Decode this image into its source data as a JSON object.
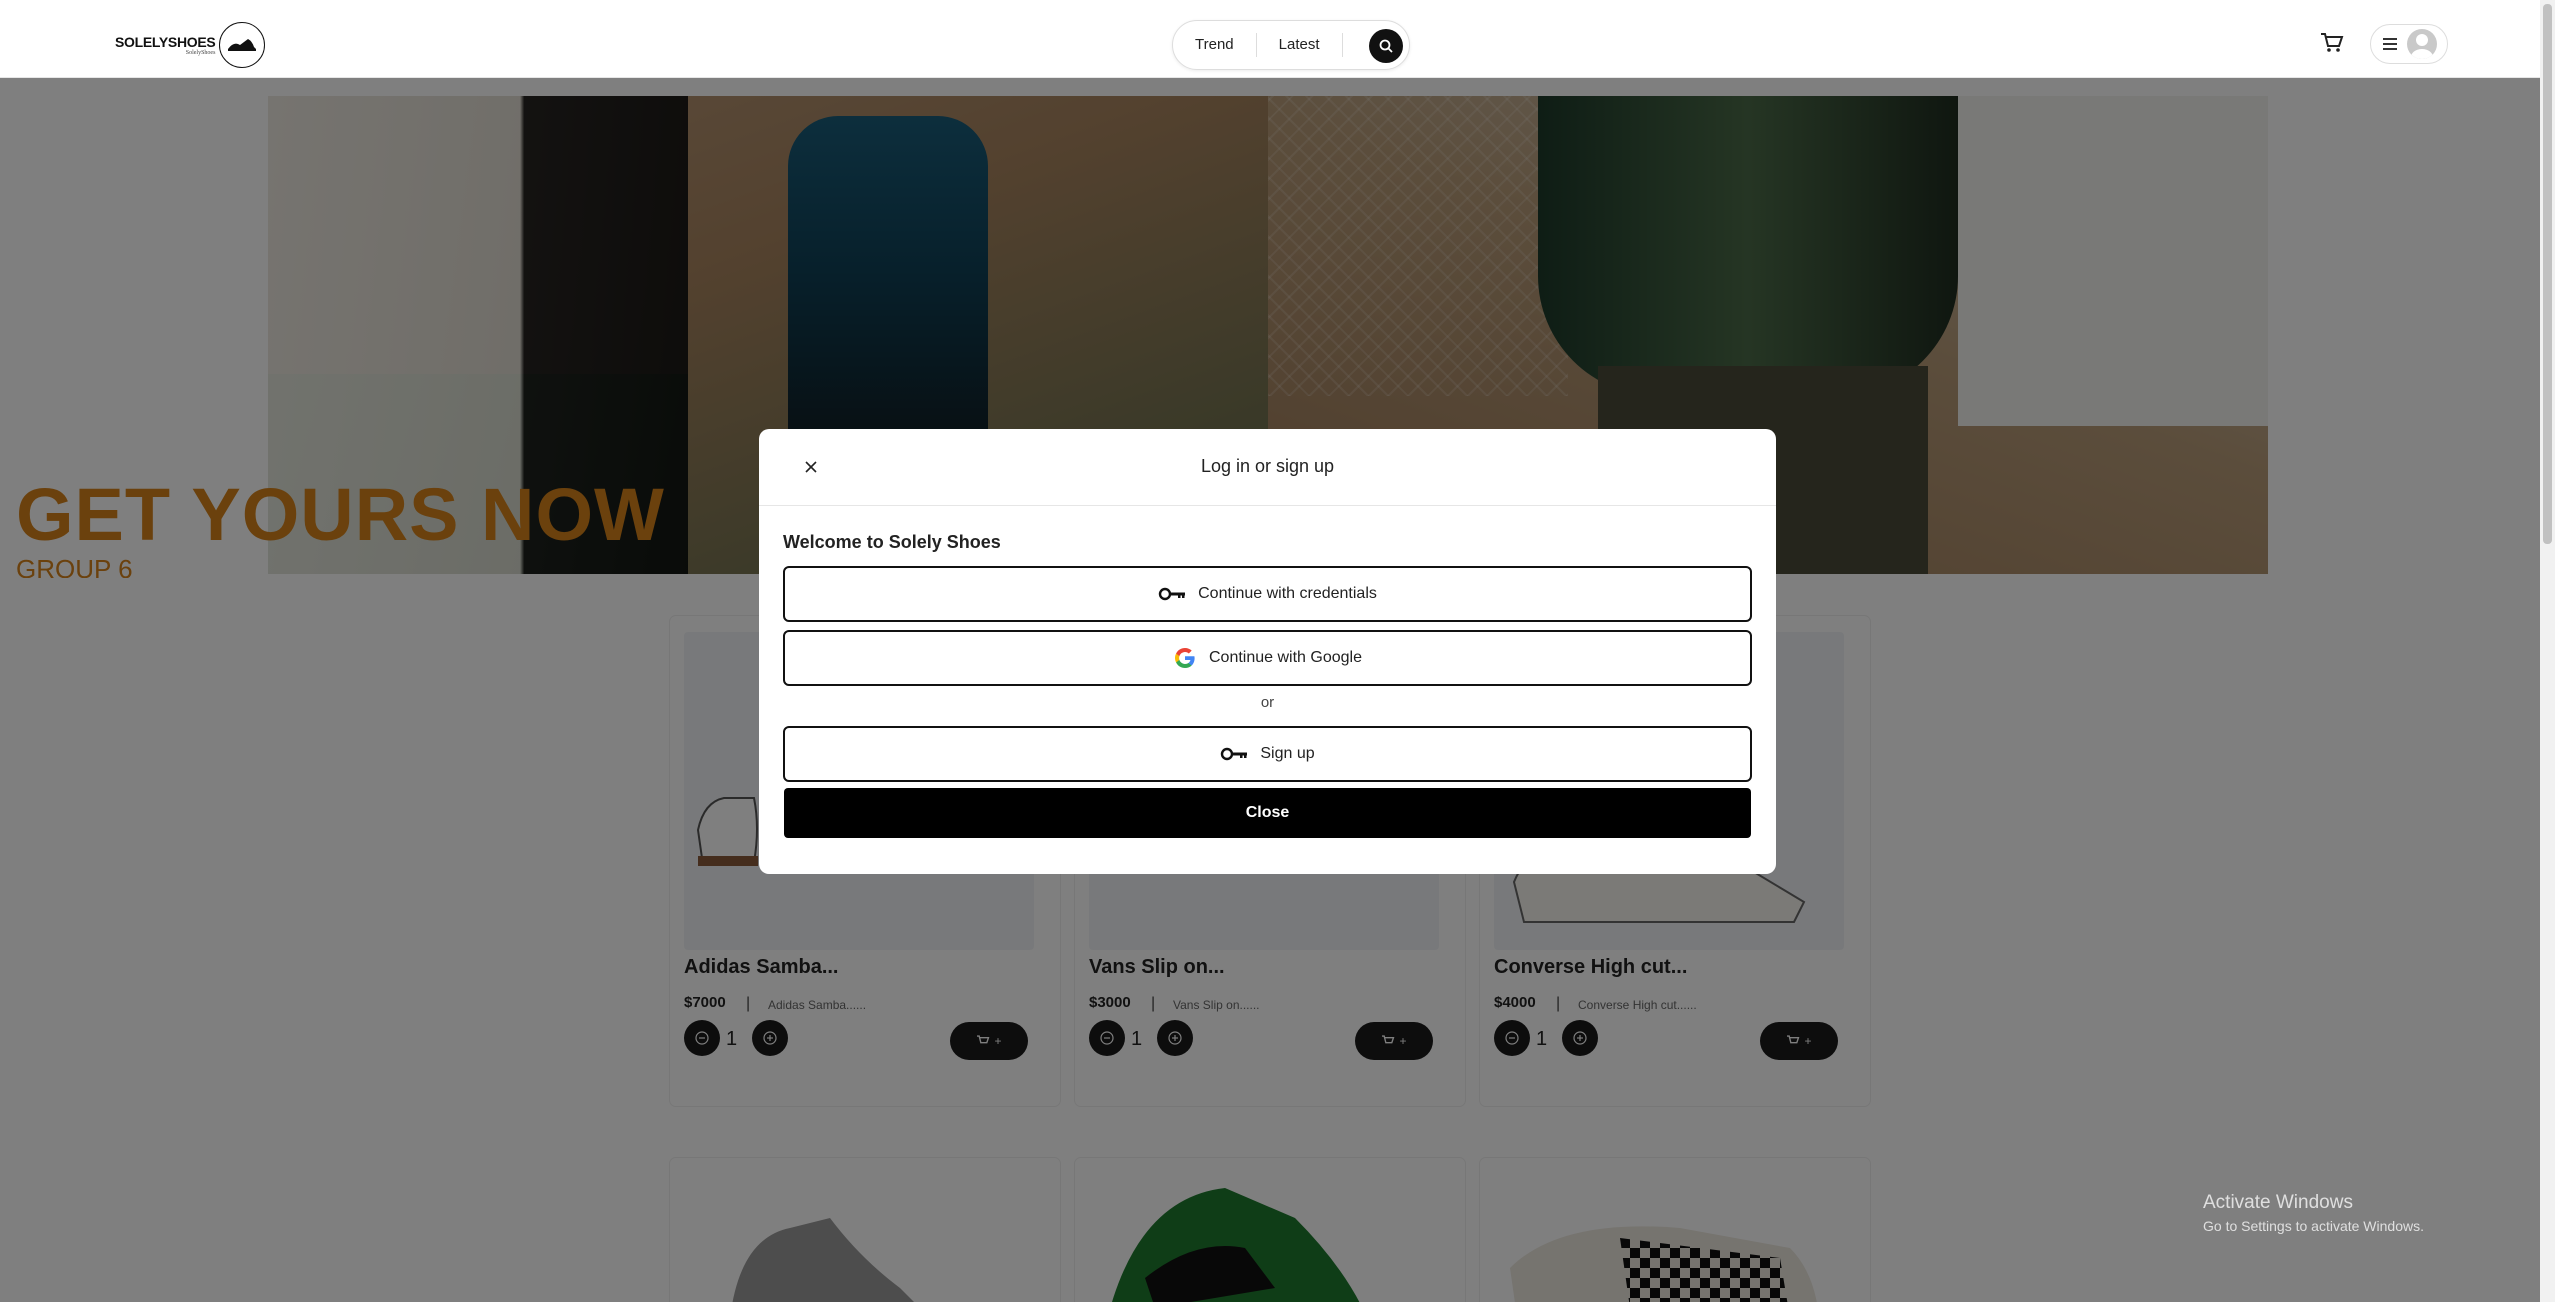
{
  "header": {
    "logo_text": "SOLELYSHOES",
    "logo_subtext": "SolelyShoes",
    "nav_links": [
      "Trend",
      "Latest"
    ]
  },
  "hero": {
    "title": "GET YOURS NOW",
    "subtitle": "GROUP 6"
  },
  "products": [
    {
      "name": "Adidas Samba...",
      "price": "$7000",
      "description": "Adidas Samba......",
      "quantity": "1"
    },
    {
      "name": "Vans Slip on...",
      "price": "$3000",
      "description": "Vans Slip on......",
      "quantity": "1"
    },
    {
      "name": "Converse High cut...",
      "price": "$4000",
      "description": "Converse High cut......",
      "quantity": "1"
    }
  ],
  "modal": {
    "title": "Log in or sign up",
    "welcome": "Welcome to Solely Shoes",
    "credentials_label": "Continue with credentials",
    "google_label": "Continue with Google",
    "or_label": "or",
    "signup_label": "Sign up",
    "close_label": "Close"
  },
  "system": {
    "activate_title": "Activate Windows",
    "activate_subtitle": "Go to Settings to activate Windows."
  },
  "colors": {
    "accent": "#d6831a",
    "button_dark": "#000000"
  }
}
